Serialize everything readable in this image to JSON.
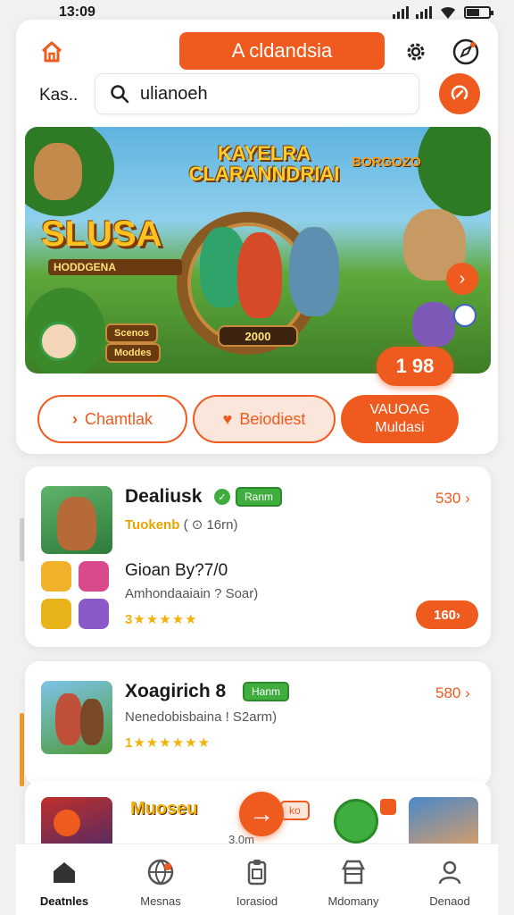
{
  "status_bar": {
    "time": "13:09"
  },
  "header": {
    "title": "A cldandsia",
    "search_label": "Kas..",
    "search_value": "ulianoeh"
  },
  "banner": {
    "headline": "KAYELRA CLARANNDRIAI",
    "side_title": "BORGOZO",
    "logo": "SLUSA",
    "logo_sub": "HODDGENA",
    "chip_1": "Scenos",
    "chip_2": "Moddes",
    "mid_tag": "2000",
    "price": "1 98"
  },
  "filters": {
    "pill_1": "Chamtlak",
    "pill_2": "Beiodiest",
    "pill_3_line1": "VAUOAG",
    "pill_3_line2": "Muldasi"
  },
  "cards": [
    {
      "title": "Dealiusk",
      "tag": "Ranm",
      "meta_accent": "Tuokenb",
      "meta_rest": "( ⊙ 16rn)",
      "right_link": "530 ›",
      "sub_title": "Gioan By?7/0",
      "sub_meta": "Amhondaaiain ? Soar)",
      "rating": "3★★★★★",
      "cta": "160›"
    },
    {
      "title": "Xoagirich 8",
      "tag": "Hanm",
      "meta": "Nenedobisbaina ! S2arm)",
      "rating": "1★★★★★★",
      "right_link": "580 ›"
    },
    {
      "title": "Muoseu",
      "side_tag": "ko",
      "meta": "3.0m"
    }
  ],
  "nav": [
    {
      "label": "Deatnles",
      "icon": "home-icon"
    },
    {
      "label": "Mesnas",
      "icon": "globe-icon"
    },
    {
      "label": "Iorasiod",
      "icon": "clipboard-icon"
    },
    {
      "label": "Mdomany",
      "icon": "shop-icon"
    },
    {
      "label": "Denaod",
      "icon": "profile-icon"
    }
  ],
  "colors": {
    "accent": "#ef5a1e",
    "green": "#3fae3f",
    "star": "#f2b20a"
  }
}
